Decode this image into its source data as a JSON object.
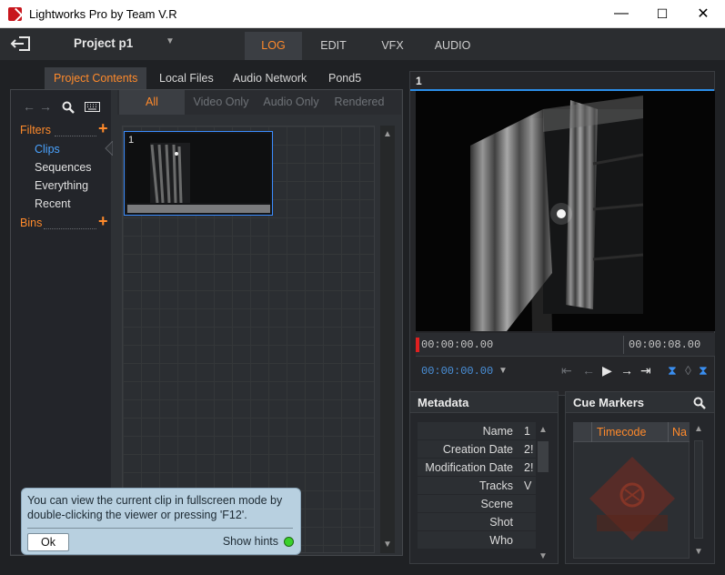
{
  "window": {
    "title": "Lightworks Pro by Team V.R",
    "controls": {
      "minimize": "—",
      "maximize": "☐",
      "close": "✕"
    }
  },
  "topbar": {
    "project_name": "Project p1",
    "tabs": [
      {
        "label": "LOG",
        "active": true
      },
      {
        "label": "EDIT",
        "active": false
      },
      {
        "label": "VFX",
        "active": false
      },
      {
        "label": "AUDIO",
        "active": false
      }
    ]
  },
  "browser": {
    "tabs": [
      {
        "label": "Project Contents",
        "active": true
      },
      {
        "label": "Local Files",
        "active": false
      },
      {
        "label": "Audio Network",
        "active": false
      },
      {
        "label": "Pond5",
        "active": false
      }
    ],
    "filters_label": "Filters",
    "filters": [
      {
        "label": "Clips",
        "active": true
      },
      {
        "label": "Sequences",
        "active": false
      },
      {
        "label": "Everything",
        "active": false
      },
      {
        "label": "Recent",
        "active": false
      }
    ],
    "bins_label": "Bins",
    "filter_tabs": [
      {
        "label": "All",
        "active": true
      },
      {
        "label": "Video Only",
        "active": false
      },
      {
        "label": "Audio Only",
        "active": false
      },
      {
        "label": "Rendered",
        "active": false
      }
    ],
    "clip": {
      "number": "1"
    }
  },
  "hint": {
    "text": "You can view the current clip in fullscreen mode by double-clicking the viewer or pressing 'F12'.",
    "ok_label": "Ok",
    "show_hints_label": "Show hints"
  },
  "viewer": {
    "number": "1",
    "timecode_start": "00:00:00.00",
    "timecode_end": "00:00:08.00",
    "current_timecode": "00:00:00.00"
  },
  "metadata": {
    "title": "Metadata",
    "rows": [
      {
        "label": "Name",
        "value": "1"
      },
      {
        "label": "Creation Date",
        "value": "2!"
      },
      {
        "label": "Modification Date",
        "value": "2!"
      },
      {
        "label": "Tracks",
        "value": "V"
      },
      {
        "label": "Scene",
        "value": ""
      },
      {
        "label": "Shot",
        "value": ""
      },
      {
        "label": "Who",
        "value": ""
      }
    ]
  },
  "cue_markers": {
    "title": "Cue Markers",
    "columns": [
      "Timecode",
      "Na"
    ]
  },
  "colors": {
    "accent_orange": "#ff8a2b",
    "selection_blue": "#4aa3ff",
    "hint_bg": "#b8d0e0",
    "led_green": "#3ad12a"
  }
}
